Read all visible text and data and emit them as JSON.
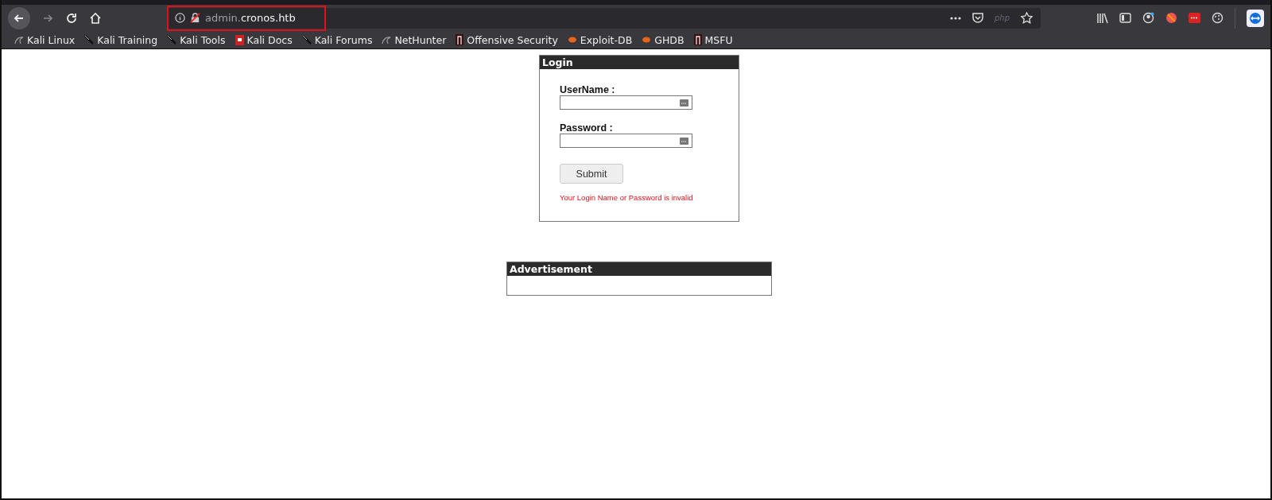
{
  "browser": {
    "url_prefix": "admin.",
    "url_host": "cronos.htb",
    "url_badge": "php",
    "url_highlighted": true,
    "bookmarks": [
      {
        "label": "Kali Linux",
        "kind": "dragon"
      },
      {
        "label": "Kali Training",
        "kind": "knife"
      },
      {
        "label": "Kali Tools",
        "kind": "knife"
      },
      {
        "label": "Kali Docs",
        "kind": "doc"
      },
      {
        "label": "Kali Forums",
        "kind": "knife"
      },
      {
        "label": "NetHunter",
        "kind": "dragon"
      },
      {
        "label": "Offensive Security",
        "kind": "tower"
      },
      {
        "label": "Exploit-DB",
        "kind": "bug"
      },
      {
        "label": "GHDB",
        "kind": "bug"
      },
      {
        "label": "MSFU",
        "kind": "tower"
      }
    ]
  },
  "login": {
    "title": "Login",
    "fields": [
      {
        "label": "UserName :"
      },
      {
        "label": "Password :"
      }
    ],
    "submit": "Submit",
    "error": "Your Login Name or Password is invalid"
  },
  "advertisement": {
    "title": "Advertisement"
  }
}
